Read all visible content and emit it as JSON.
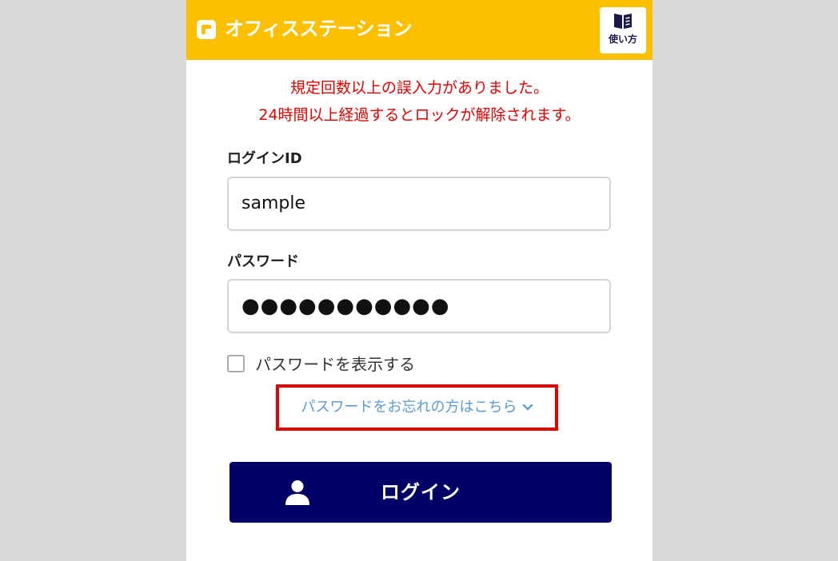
{
  "header": {
    "app_title": "オフィスステーション",
    "help_label": "使い方",
    "logo_icon": "app-logo-icon",
    "help_icon": "book-icon"
  },
  "error": {
    "line1": "規定回数以上の誤入力がありました。",
    "line2": "24時間以上経過するとロックが解除されます。"
  },
  "form": {
    "login_id_label": "ログインID",
    "login_id_value": "sample",
    "password_label": "パスワード",
    "password_mask": "●●●●●●●●●●●",
    "show_password_label": "パスワードを表示する",
    "show_password_checked": false,
    "forgot_link": "パスワードをお忘れの方はこちら",
    "forgot_icon": "chevron-down-icon",
    "login_button": "ログイン",
    "login_icon": "user-icon"
  },
  "colors": {
    "header_bg": "#fcc000",
    "error_text": "#e60000",
    "link_text": "#5b9bd5",
    "highlight_border": "#e60000",
    "login_button_bg": "#000066"
  }
}
